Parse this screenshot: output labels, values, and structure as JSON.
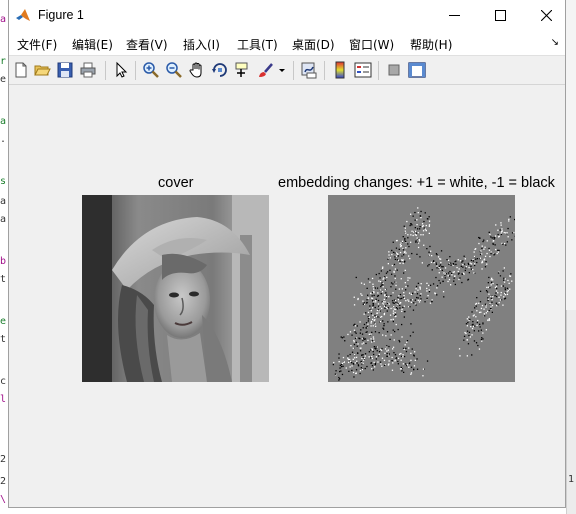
{
  "window": {
    "title": "Figure 1"
  },
  "menu": [
    "文件(F)",
    "编辑(E)",
    "查看(V)",
    "插入(I)",
    "工具(T)",
    "桌面(D)",
    "窗口(W)",
    "帮助(H)"
  ],
  "toolbar_icons": [
    "new-figure-icon",
    "open-file-icon",
    "save-icon",
    "print-icon",
    "pointer-icon",
    "zoom-in-icon",
    "zoom-out-icon",
    "pan-icon",
    "rotate-3d-icon",
    "data-cursor-icon",
    "brush-icon",
    "brush-dropdown-icon",
    "link-plot-icon",
    "colorbar-icon",
    "legend-icon",
    "hide-plot-tools-icon",
    "show-plot-tools-icon"
  ],
  "axes": [
    {
      "title": "cover",
      "content": "grayscale portrait image"
    },
    {
      "title": "embedding changes: +1 = white, -1 = black",
      "content": "sparse noise map on gray background"
    }
  ],
  "background_code": {
    "left_margin_chars": [
      "a",
      "r",
      "e",
      "",
      "a",
      ".",
      "",
      "s",
      "a",
      "a",
      "",
      "b",
      "t",
      "",
      "e",
      "t",
      "",
      "c",
      "l",
      "",
      "2",
      "2",
      "\\"
    ],
    "right_margin_chars": [
      "1"
    ]
  },
  "colors": {
    "window_bg": "#f0f0f0",
    "titlebar_bg": "#ffffff",
    "noise_gray": "#808080"
  }
}
